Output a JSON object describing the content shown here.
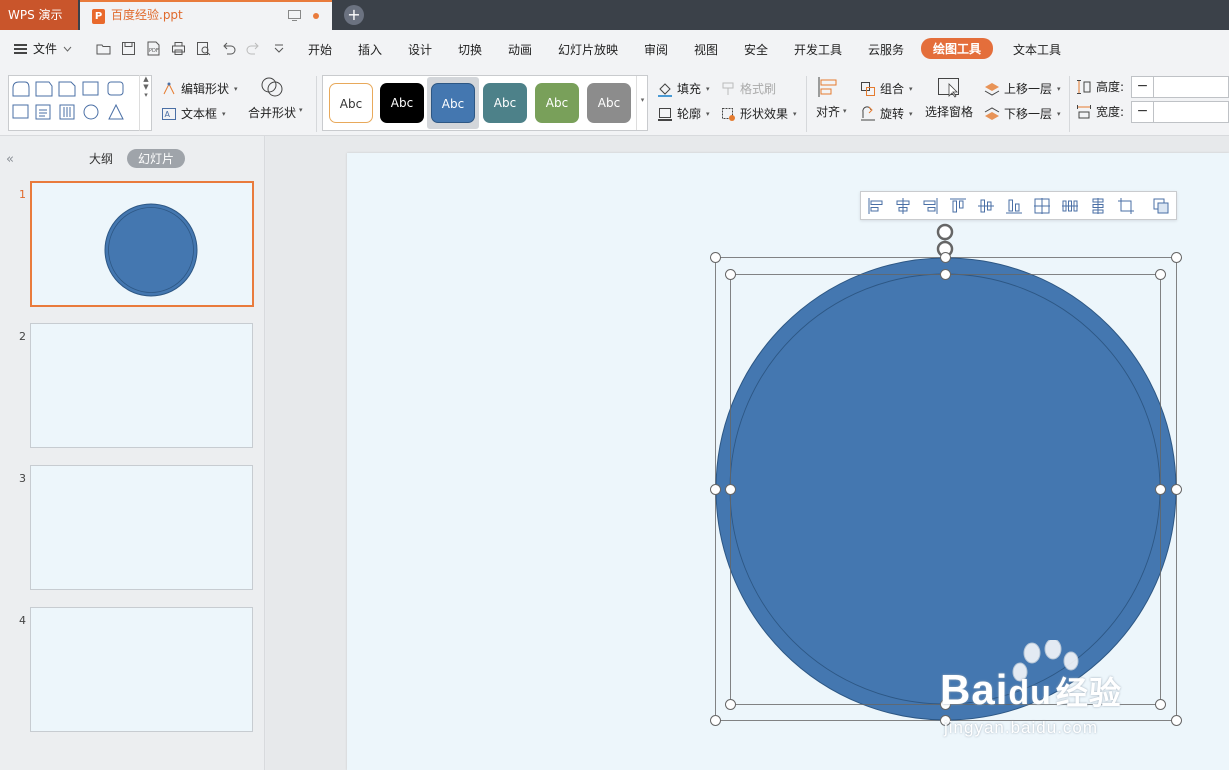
{
  "titlebar": {
    "app_name": "WPS 演示",
    "document_name": "百度经验.ppt",
    "ppt_icon_letter": "P"
  },
  "menubar": {
    "file_label": "文件",
    "tabs": [
      "开始",
      "插入",
      "设计",
      "切换",
      "动画",
      "幻灯片放映",
      "审阅",
      "视图",
      "安全",
      "开发工具",
      "云服务",
      "绘图工具",
      "文本工具"
    ],
    "active_tab": "绘图工具"
  },
  "ribbon": {
    "edit_shape": "编辑形状",
    "text_box": "文本框",
    "merge_shape": "合并形状",
    "style_swatches": [
      "Abc",
      "Abc",
      "Abc",
      "Abc",
      "Abc",
      "Abc"
    ],
    "fill": "填充",
    "format_painter": "格式刷",
    "outline": "轮廓",
    "shape_effects": "形状效果",
    "align": "对齐",
    "group": "组合",
    "rotate": "旋转",
    "selection_pane": "选择窗格",
    "bring_forward": "上移一层",
    "send_backward": "下移一层",
    "height_label": "高度:",
    "width_label": "宽度:",
    "minus": "−"
  },
  "sidebar": {
    "outline_tab": "大纲",
    "slides_tab": "幻灯片",
    "collapse": "«",
    "slides": [
      {
        "number": "1"
      },
      {
        "number": "2"
      },
      {
        "number": "3"
      },
      {
        "number": "4"
      }
    ]
  },
  "colors": {
    "accent": "#e46e3b",
    "shape_fill": "#4477b0",
    "shape_stroke": "#2d5784",
    "slide_bg": "#edf6fb"
  },
  "watermark": {
    "brand": "Bai",
    "brand2": "du",
    "suffix": "经验",
    "url": "jingyan.baidu.com"
  }
}
